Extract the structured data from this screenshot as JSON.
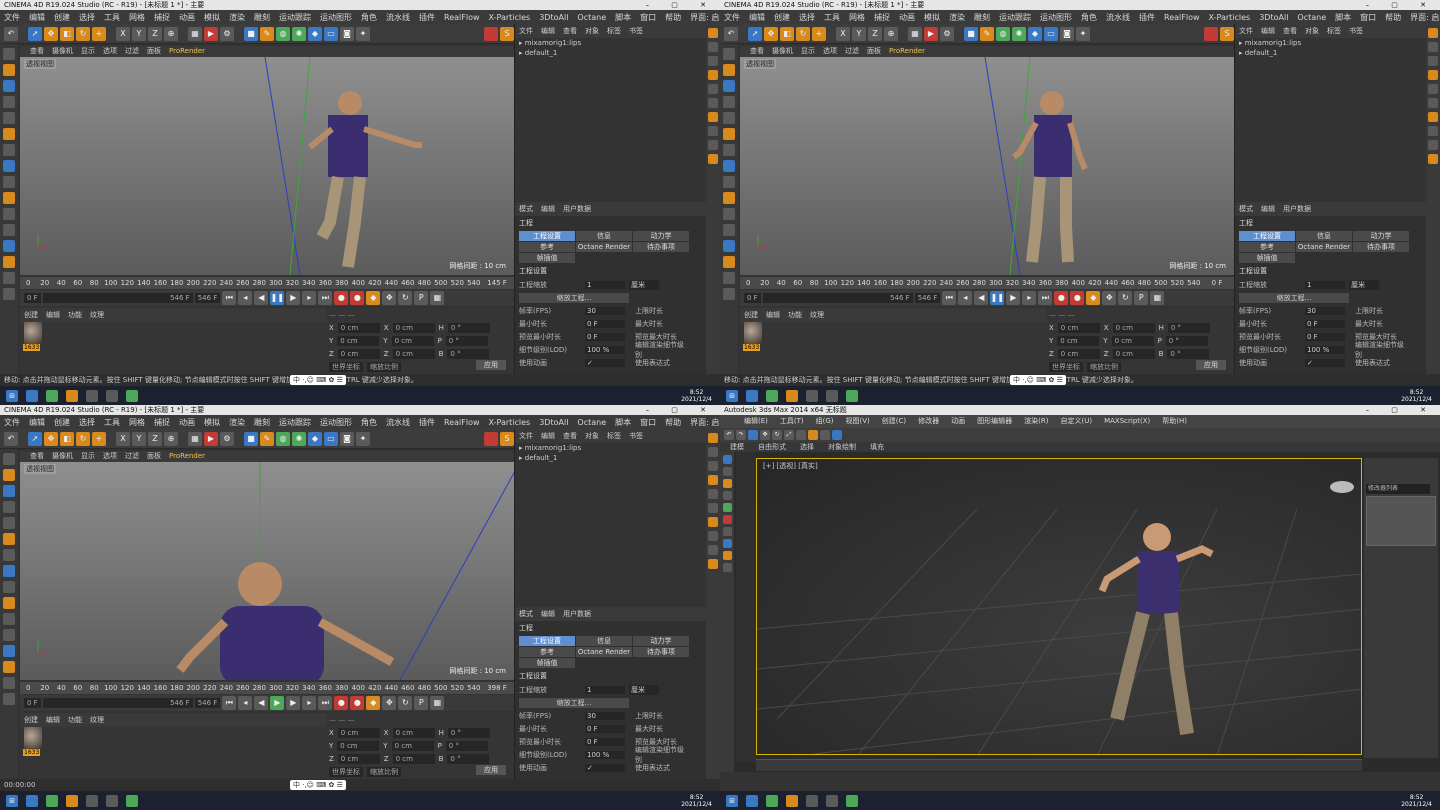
{
  "c4d": {
    "title": "CINEMA 4D R19.024 Studio (RC - R19) - [未标题 1 *] - 主要",
    "menus": [
      "文件",
      "编辑",
      "创建",
      "选择",
      "工具",
      "网格",
      "捕捉",
      "动画",
      "模拟",
      "渲染",
      "雕刻",
      "运动跟踪",
      "运动图形",
      "角色",
      "流水线",
      "插件",
      "RealFlow",
      "X-Particles",
      "3DtoAll",
      "Octane",
      "脚本",
      "窗口",
      "帮助"
    ],
    "layout_label": "界面:",
    "layout_value": "启动 (用户)",
    "viewport_menu": [
      "查看",
      "摄像机",
      "显示",
      "选项",
      "过滤",
      "面板"
    ],
    "prorender": "ProRender",
    "viewport_label": "透视视图",
    "grid_text": "网格间距 : 10 cm",
    "timeline_ticks": [
      "0",
      "20",
      "40",
      "60",
      "80",
      "100",
      "120",
      "140",
      "160",
      "180",
      "200",
      "220",
      "240",
      "260",
      "280",
      "300",
      "320",
      "340",
      "360",
      "380",
      "400",
      "420",
      "440",
      "460",
      "480",
      "500",
      "520",
      "540"
    ],
    "frame_start": "0 F",
    "frame_end": "546 F",
    "frame_total": "546 F",
    "current_frames": [
      "145 F",
      "0 F",
      "398 F"
    ],
    "mat_tabs": [
      "创建",
      "编辑",
      "功能",
      "纹理"
    ],
    "mat_name": "1633",
    "coord_rows": [
      [
        "X",
        "0 cm",
        "X",
        "0 cm",
        "H",
        "0 °"
      ],
      [
        "Y",
        "0 cm",
        "Y",
        "0 cm",
        "P",
        "0 °"
      ],
      [
        "Z",
        "0 cm",
        "Z",
        "0 cm",
        "B",
        "0 °"
      ]
    ],
    "coord_buttons": [
      "世界坐标",
      "缩放比例",
      "应用"
    ],
    "obj_menu": [
      "文件",
      "编辑",
      "查看",
      "对象",
      "标签",
      "书签"
    ],
    "obj_items": [
      "mixamorig1:lips",
      "default_1"
    ],
    "attr_menu": [
      "模式",
      "编辑",
      "用户数据"
    ],
    "attr_header": "工程",
    "attr_tabs": [
      "工程设置",
      "信息",
      "动力学",
      "参考",
      "Octane Render",
      "待办事项",
      "帧插值"
    ],
    "attr_section": "工程设置",
    "scale_label": "工程缩放",
    "scale_value": "1",
    "scale_unit": "厘米",
    "scale_btn": "缩放工程...",
    "props": [
      [
        "帧率(FPS)",
        "30",
        "上限时长"
      ],
      [
        "最小时长",
        "0 F",
        "最大时长"
      ],
      [
        "预览最小时长",
        "0 F",
        "预览最大时长"
      ],
      [
        "细节级别(LOD)",
        "100 %",
        "编辑渲染细节级别"
      ],
      [
        "使用动画",
        "✓",
        "使用表达式"
      ]
    ],
    "status": "移动: 点击并拖动鼠标移动元素。按住 SHIFT 键量化移动; 节点编辑模式时按住 SHIFT 键增加选择对象; 按住 CTRL 键减少选择对象。",
    "status3": "00:00:00",
    "clock": [
      "8:52",
      "2021/12/4"
    ],
    "ime": "中 ·,☺ ⌨ ✿ ☰"
  },
  "max": {
    "title": "Autodesk 3ds Max 2014 x64    无标题",
    "menus": [
      "编辑(E)",
      "工具(T)",
      "组(G)",
      "视图(V)",
      "创建(C)",
      "修改器",
      "动画",
      "图形编辑器",
      "渲染(R)",
      "自定义(U)",
      "MAXScript(X)",
      "帮助(H)"
    ],
    "ribbon": [
      "建模",
      "自由形式",
      "选择",
      "对象绘制",
      "填充"
    ],
    "viewport_label": "[+] [透视] [真实]",
    "cmd_input": "修改器列表",
    "clock": [
      "8:52",
      "2021/12/4"
    ]
  }
}
